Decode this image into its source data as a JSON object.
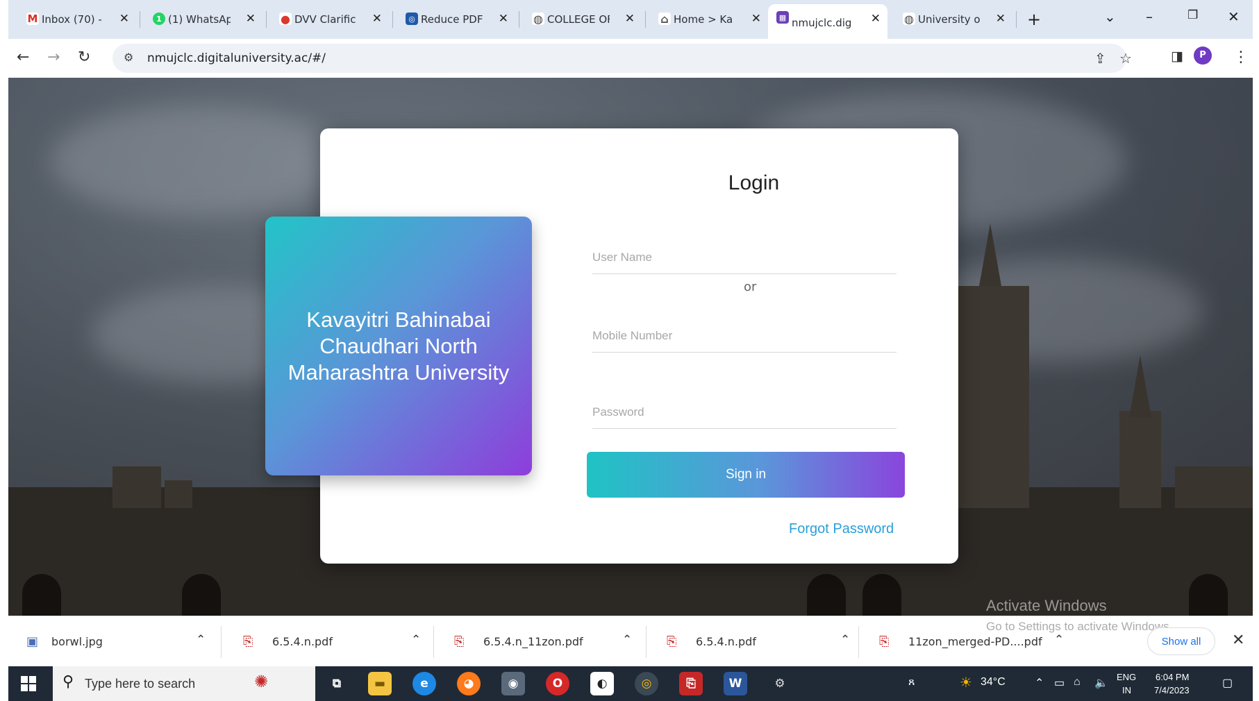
{
  "browser": {
    "tabs": [
      {
        "label": "Inbox (70) -",
        "favicon": "gmail-icon",
        "color": "#d93025",
        "glyph": "M"
      },
      {
        "label": "(1) WhatsAp",
        "favicon": "whatsapp-icon",
        "color": "#25d366",
        "glyph": "1"
      },
      {
        "label": "DVV Clarific",
        "favicon": "site-icon",
        "color": "#d9392b",
        "glyph": "●"
      },
      {
        "label": "Reduce PDF",
        "favicon": "ilovepdf-icon",
        "color": "#1e5aa8",
        "glyph": "◎"
      },
      {
        "label": "COLLEGE OF",
        "favicon": "globe-icon",
        "color": "#555555",
        "glyph": "◍"
      },
      {
        "label": "Home > Ka",
        "favicon": "site-icon",
        "color": "#777777",
        "glyph": "⌂"
      },
      {
        "label": "nmujclc.dig",
        "favicon": "university-icon",
        "color": "#6b3fb5",
        "glyph": "▦"
      },
      {
        "label": "University o",
        "favicon": "globe-icon",
        "color": "#555555",
        "glyph": "◍"
      }
    ],
    "active_tab": 6,
    "url": "nmujclc.digitaluniversity.ac/#/",
    "profile_initial": "P"
  },
  "login": {
    "brand_name": "Kavayitri Bahinabai Chaudhari North Maharashtra University",
    "title": "Login",
    "username_placeholder": "User Name",
    "or_text": "or",
    "mobile_placeholder": "Mobile Number",
    "password_placeholder": "Password",
    "signin_label": "Sign in",
    "forgot_label": "Forgot Password",
    "accent_color": "#2a9fd8"
  },
  "watermark": {
    "title": "Activate Windows",
    "subtitle": "Go to Settings to activate Windows."
  },
  "downloads": {
    "items": [
      {
        "name": "borwl.jpg",
        "type": "image"
      },
      {
        "name": "6.5.4.n.pdf",
        "type": "pdf"
      },
      {
        "name": "6.5.4.n_11zon.pdf",
        "type": "pdf"
      },
      {
        "name": "6.5.4.n.pdf",
        "type": "pdf"
      },
      {
        "name": "11zon_merged-PD....pdf",
        "type": "pdf"
      }
    ],
    "show_all_label": "Show all"
  },
  "taskbar": {
    "search_placeholder": "Type here to search",
    "temperature": "34°C",
    "language": "ENG",
    "region": "IN",
    "time": "6:04 PM",
    "date": "7/4/2023"
  }
}
